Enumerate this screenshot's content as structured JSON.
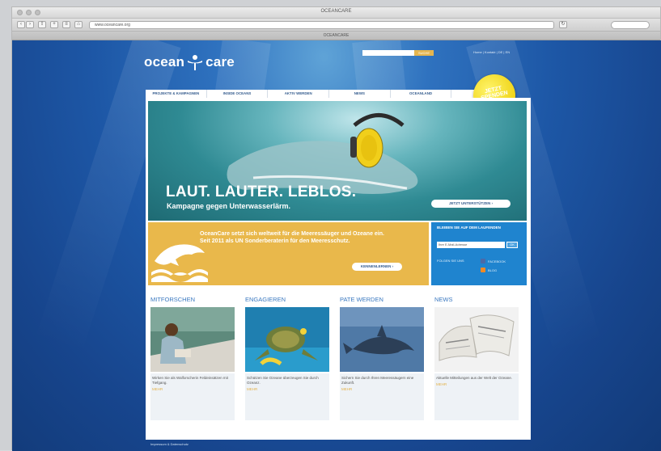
{
  "browser": {
    "window_title": "OCEANCARE",
    "url": "www.oceancare.org",
    "tab_label": "OCEANCARE"
  },
  "site": {
    "logo_left": "ocean",
    "logo_right": "care",
    "search_button": "SUCHE",
    "languages": "Home | Kontakt | DE | EN"
  },
  "nav": {
    "items": [
      {
        "label": "PROJEKTE & KAMPAGNEN"
      },
      {
        "label": "INSIDE OCEANS"
      },
      {
        "label": "AKTIV WERDEN"
      },
      {
        "label": "NEWS"
      },
      {
        "label": "OCEANLAND"
      },
      {
        "label": "SHOP"
      }
    ]
  },
  "donate": {
    "line1": "JETZT",
    "line2": "SPENDEN"
  },
  "hero": {
    "title": "LAUT. LAUTER. LEBLOS.",
    "subtitle": "Kampagne gegen Unterwasserlärm.",
    "button": "JETZT UNTERSTÜTZEN ›"
  },
  "promo": {
    "text": "OceanCare setzt sich weltweit für die Meeressäuger und Ozeane ein. Seit 2011 als UN Sonderberaterin für den Meeresschutz.",
    "button": "KENNENLERNEN ›"
  },
  "signup": {
    "title": "BLEIBEN SIE AUF DEM LAUFENDEN",
    "placeholder": "Ihre E-Mail-Adresse",
    "button": "OK",
    "follow": "FOLGEN SIE UNS",
    "facebook": "FACEBOOK",
    "blog": "BLOG",
    "facebook_color": "#4a6aa8",
    "blog_color": "#f08a24"
  },
  "sections": [
    {
      "heading": "MITFORSCHEN",
      "caption": "Wirken Sie als Walforscherin Feldeinsätzen mit Tiefgang.",
      "more": "MEHR",
      "icon": "research-photo"
    },
    {
      "heading": "ENGAGIEREN",
      "caption": "Schützen Sie Ozeane überzeugen Sie durch Ozeanz.",
      "more": "MEHR",
      "icon": "turtle-photo"
    },
    {
      "heading": "PATE WERDEN",
      "caption": "Sichern Sie durch Ihren Meeressäugern eine Zukunft.",
      "more": "MEHR",
      "icon": "dolphin-photo"
    },
    {
      "heading": "NEWS",
      "caption": "Aktuelle Mitteilungen aus der Welt der Ozeane.",
      "more": "MEHR",
      "icon": "newspaper-photo"
    }
  ],
  "footer": {
    "text": "Impressum & Datenschutz"
  }
}
